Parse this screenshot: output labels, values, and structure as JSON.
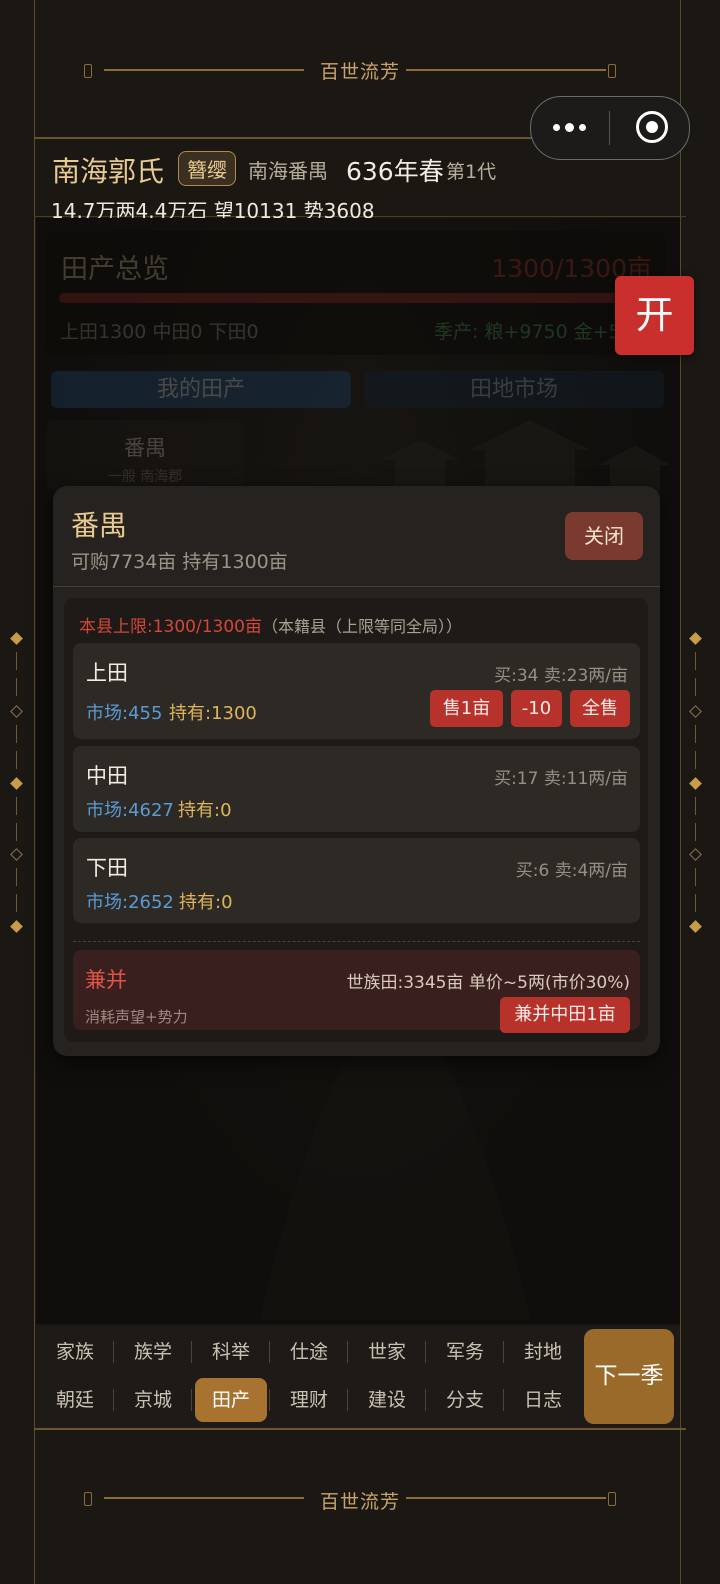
{
  "banner": {
    "top_text": "百世流芳",
    "bottom_text": "百世流芳"
  },
  "header": {
    "family_name": "南海郭氏",
    "rank_badge": "簪缨",
    "location": "南海番禺",
    "year": "636年春",
    "generation": "第1代",
    "stats": "14.7万两4.4万石  望10131 势3608"
  },
  "overview": {
    "title": "田产总览",
    "value": "1300/1300亩",
    "summary": "上田1300 中田0 下田0",
    "yield": "季产: 粮+9750 金+5"
  },
  "tabs": [
    "我的田产",
    "田地市场"
  ],
  "county_card": {
    "name": "番禺",
    "sub": "一般 南海郡"
  },
  "open_button": "开",
  "modal": {
    "title": "番禺",
    "subtitle": "可购7734亩   持有1300亩",
    "close_label": "关闭",
    "limit_text": "本县上限:1300/1300亩",
    "limit_note": "（本籍县（上限等同全局））",
    "lands": [
      {
        "name": "上田",
        "price": "买:34 卖:23两/亩",
        "market": "市场:455",
        "held": "持有:1300"
      },
      {
        "name": "中田",
        "price": "买:17 卖:11两/亩",
        "market": "市场:4627",
        "held": "持有:0"
      },
      {
        "name": "下田",
        "price": "买:6 卖:4两/亩",
        "market": "市场:2652",
        "held": "持有:0"
      }
    ],
    "sell_buttons": [
      "售1亩",
      "-10",
      "全售"
    ],
    "merge": {
      "title": "兼并",
      "info": "世族田:3345亩 单价~5两(市价30%)",
      "cost": "消耗声望+势力",
      "button": "兼并中田1亩"
    }
  },
  "nav": {
    "row1": [
      "家族",
      "族学",
      "科举",
      "仕途",
      "世家",
      "军务",
      "封地"
    ],
    "row2": [
      "朝廷",
      "京城",
      "田产",
      "理财",
      "建设",
      "分支",
      "日志"
    ],
    "active": "田产",
    "next_label": "下一季"
  },
  "colors": {
    "accent_gold": "#c9a36a",
    "danger_red": "#b8322c",
    "market_blue": "#5a9ad6",
    "active_tab": "#a87231"
  }
}
